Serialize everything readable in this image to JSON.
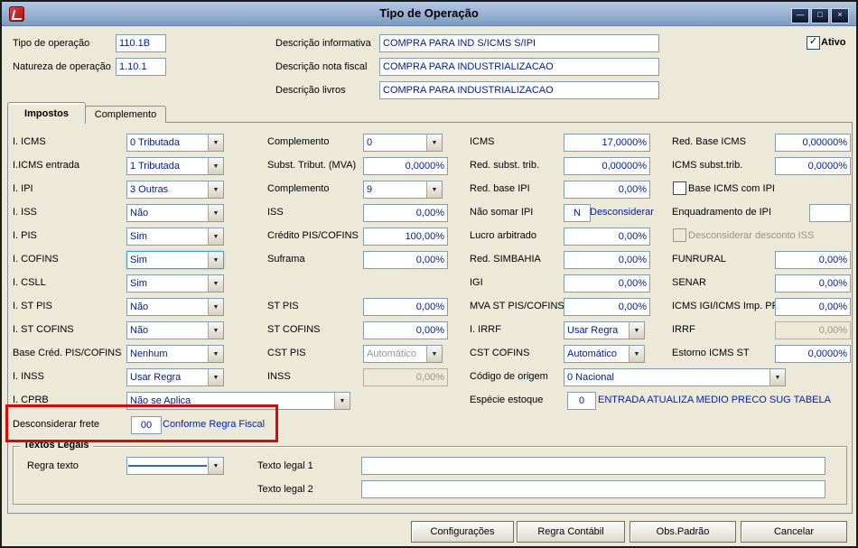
{
  "icons": {
    "dropdown_arrow": "▼",
    "check": "✓",
    "minimize": "—",
    "maximize": "□",
    "close": "×"
  },
  "colors": {
    "highlight_red": "#dd0806",
    "selection_blue": "#2e66c6",
    "value_navy": "#001a96",
    "note_blue": "#0020c0"
  },
  "window": {
    "title": "Tipo de Operação"
  },
  "header": {
    "tipo": {
      "label": "Tipo de operação",
      "value": "110.1B"
    },
    "natureza": {
      "label": "Natureza de operação",
      "value": "1.10.1"
    },
    "desc_informativa": {
      "label": "Descrição informativa",
      "value": "COMPRA PARA IND S/ICMS S/IPI"
    },
    "desc_nota_fiscal": {
      "label": "Descrição nota fiscal",
      "value": "COMPRA PARA INDUSTRIALIZACAO"
    },
    "desc_livros": {
      "label": "Descrição livros",
      "value": "COMPRA PARA INDUSTRIALIZACAO"
    },
    "ativo": {
      "label": "Ativo",
      "checked": true
    }
  },
  "tabs": {
    "impostos": "Impostos",
    "complemento": "Complemento"
  },
  "impostos": {
    "c1": [
      {
        "label": "I. ICMS",
        "value": "0 Tributada"
      },
      {
        "label": "I.ICMS entrada",
        "value": "1 Tributada"
      },
      {
        "label": "I. IPI",
        "value": "3 Outras"
      },
      {
        "label": "I. ISS",
        "value": "Não"
      },
      {
        "label": "I. PIS",
        "value": "Sim"
      },
      {
        "label": "I. COFINS",
        "value": "Sim"
      },
      {
        "label": "I. CSLL",
        "value": "Sim"
      },
      {
        "label": "I. ST PIS",
        "value": "Não"
      },
      {
        "label": "I. ST COFINS",
        "value": "Não"
      },
      {
        "label": "Base Créd. PIS/COFINS",
        "value": "Nenhum"
      },
      {
        "label": "I. INSS",
        "value": "Usar Regra"
      },
      {
        "label": "I. CPRB",
        "value": "Não se Aplica"
      }
    ],
    "frete": {
      "label": "Desconsiderar frete",
      "value": "00",
      "note": "Conforme Regra Fiscal"
    },
    "c2": [
      {
        "label": "Complemento",
        "value": "0"
      },
      {
        "label": "Subst. Tribut. (MVA)",
        "value": "0,0000%"
      },
      {
        "label": "Complemento",
        "value": "9"
      },
      {
        "label": "ISS",
        "value": "0,00%"
      },
      {
        "label": "Crédito PIS/COFINS",
        "value": "100,00%"
      },
      {
        "label": "Suframa",
        "value": "0,00%"
      },
      {
        "label": "ST PIS",
        "value": "0,00%"
      },
      {
        "label": "ST COFINS",
        "value": "0,00%"
      },
      {
        "label": "CST PIS",
        "value": "Automático"
      },
      {
        "label": "INSS",
        "value": "0,00%"
      }
    ],
    "c3": [
      {
        "label": "ICMS",
        "value": "17,0000%"
      },
      {
        "label": "Red. subst. trib.",
        "value": "0,00000%"
      },
      {
        "label": "Red. base IPI",
        "value": "0,00%"
      },
      {
        "label": "Não somar IPI",
        "value": "N",
        "note": "Desconsiderar"
      },
      {
        "label": "Lucro arbitrado",
        "value": "0,00%"
      },
      {
        "label": "Red. SIMBAHIA",
        "value": "0,00%"
      },
      {
        "label": "IGI",
        "value": "0,00%"
      },
      {
        "label": "MVA ST PIS/COFINS",
        "value": "0,00%"
      },
      {
        "label": "I. IRRF",
        "value": "Usar Regra"
      },
      {
        "label": "CST COFINS",
        "value": "Automático"
      },
      {
        "label": "Código de origem",
        "value": "0 Nacional"
      },
      {
        "label": "Espécie estoque",
        "value": "0",
        "note": "ENTRADA ATUALIZA MEDIO PRECO SUG TABELA"
      }
    ],
    "c4": [
      {
        "label": "Red. Base ICMS",
        "value": "0,00000%"
      },
      {
        "label": "ICMS subst.trib.",
        "value": "0,0000%"
      },
      {
        "label": "Base ICMS com IPI",
        "checked": false
      },
      {
        "label": "Enquadramento de IPI",
        "value": ""
      },
      {
        "label": "Desconsiderar desconto ISS",
        "checked": false
      },
      {
        "label": "FUNRURAL",
        "value": "0,00%"
      },
      {
        "label": "SENAR",
        "value": "0,00%"
      },
      {
        "label": "ICMS IGI/ICMS Imp. PR",
        "value": "0,00%"
      },
      {
        "label": "IRRF",
        "value": "0,00%"
      },
      {
        "label": "Estorno ICMS ST",
        "value": "0,0000%"
      }
    ]
  },
  "textos_legais": {
    "title": "Textos Legais",
    "regra_texto": {
      "label": "Regra texto",
      "value": ""
    },
    "texto1": {
      "label": "Texto legal 1",
      "value": ""
    },
    "texto2": {
      "label": "Texto legal 2",
      "value": ""
    }
  },
  "buttons": {
    "configuracoes": "Configurações",
    "regra_contabil": "Regra Contábil",
    "obs_padrao": "Obs.Padrão",
    "cancelar": "Cancelar"
  }
}
